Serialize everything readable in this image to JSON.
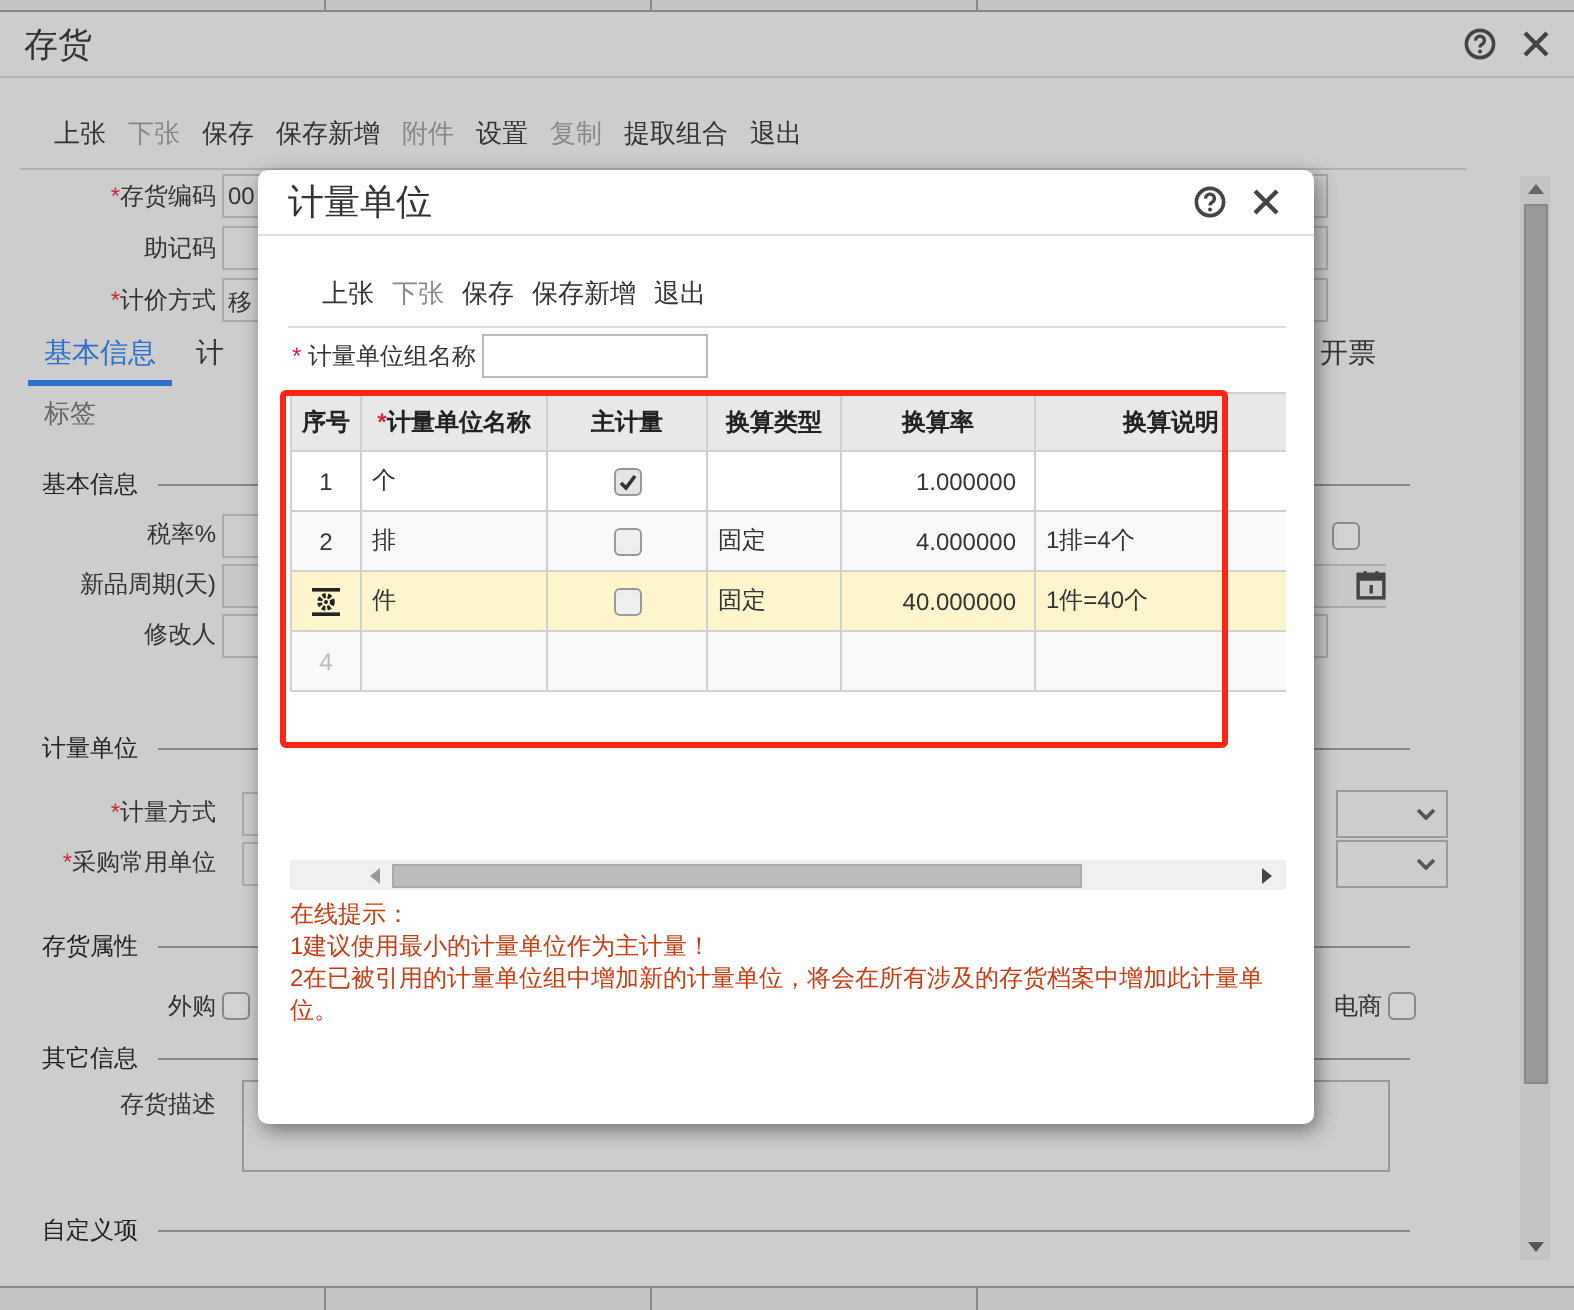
{
  "background_window": {
    "title": "存货",
    "toolbar": [
      {
        "label": "上张",
        "disabled": false
      },
      {
        "label": "下张",
        "disabled": true
      },
      {
        "label": "保存",
        "disabled": false
      },
      {
        "label": "保存新增",
        "disabled": false
      },
      {
        "label": "附件",
        "disabled": true
      },
      {
        "label": "设置",
        "disabled": false
      },
      {
        "label": "复制",
        "disabled": true
      },
      {
        "label": "提取组合",
        "disabled": false
      },
      {
        "label": "退出",
        "disabled": false
      }
    ],
    "header_fields": [
      {
        "mark": "*",
        "label": "存货编码",
        "value": "00"
      },
      {
        "label": "助记码"
      },
      {
        "mark": "*",
        "label": "计价方式",
        "value": "移"
      }
    ],
    "tabs": [
      {
        "label": "基本信息",
        "selected": true
      },
      {
        "label": "计",
        "selected": false
      },
      {
        "label": "开票",
        "selected": false
      }
    ],
    "subtab": "标签",
    "basic_info": {
      "title": "基本信息",
      "fields": [
        {
          "label": "税率%"
        },
        {
          "label": "新品周期(天)"
        },
        {
          "label": "修改人"
        }
      ],
      "right_checkbox": {
        "checked": false
      }
    },
    "units": {
      "title": "计量单位",
      "fields": [
        {
          "mark": "*",
          "label": "计量方式"
        },
        {
          "mark": "*",
          "label": "采购常用单位"
        }
      ]
    },
    "attributes": {
      "title": "存货属性",
      "checkboxes": [
        {
          "label": "外购",
          "checked": false
        },
        {
          "label": "电商",
          "checked": false
        }
      ]
    },
    "other": {
      "title": "其它信息",
      "description_label": "存货描述"
    },
    "custom": {
      "title": "自定义项"
    }
  },
  "dialog": {
    "title": "计量单位",
    "toolbar": [
      {
        "label": "上张",
        "disabled": false
      },
      {
        "label": "下张",
        "disabled": true
      },
      {
        "label": "保存",
        "disabled": false
      },
      {
        "label": "保存新增",
        "disabled": false
      },
      {
        "label": "退出",
        "disabled": false
      }
    ],
    "group_name": {
      "mark": "*",
      "label": "计量单位组名称"
    },
    "columns": [
      {
        "label": "序号"
      },
      {
        "mark": "*",
        "label": "计量单位名称"
      },
      {
        "label": "主计量"
      },
      {
        "label": "换算类型"
      },
      {
        "label": "换算率"
      },
      {
        "label": "换算说明"
      }
    ],
    "rows": [
      {
        "kind": "unit",
        "seq": "1",
        "name": "个",
        "primary": true,
        "rate": "1.000000",
        "selected": false
      },
      {
        "kind": "unit",
        "seq": "2",
        "name": "排",
        "primary": false,
        "type": "固定",
        "rate": "4.000000",
        "note": "1排=4个",
        "selected": false
      },
      {
        "kind": "unit",
        "name": "件",
        "primary": false,
        "type": "固定",
        "rate": "40.000000",
        "note": "1件=40个",
        "selected": true
      },
      {
        "kind": "blank",
        "seq": "4",
        "selected": false
      }
    ],
    "hint_title": "在线提示：",
    "hints": [
      "1建议使用最小的计量单位作为主计量！",
      "2在已被引用的计量单位组中增加新的计量单位，将会在所有涉及的存货档案中增加此计量单位。"
    ]
  }
}
